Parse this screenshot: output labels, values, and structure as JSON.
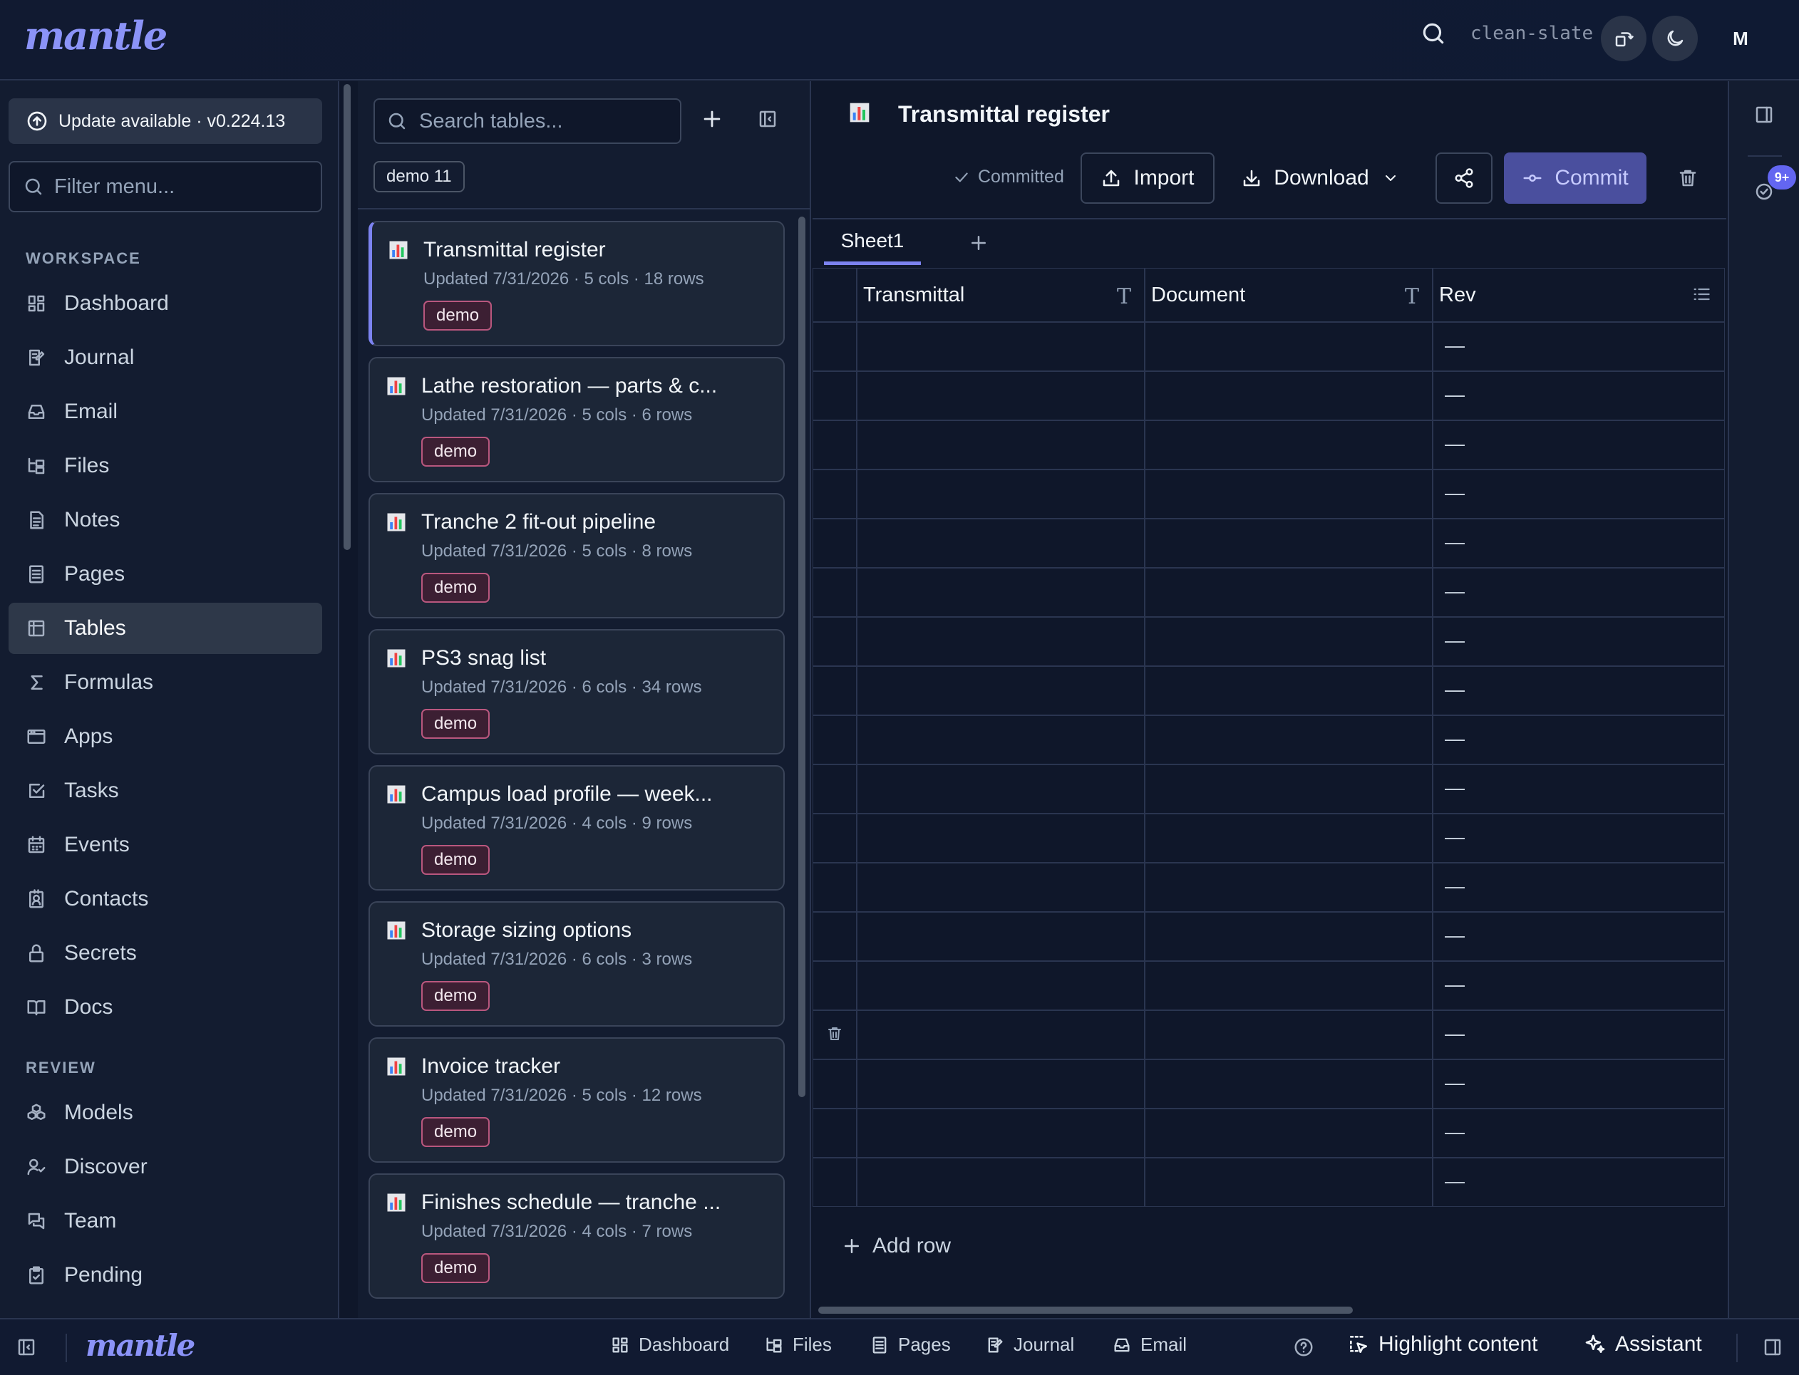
{
  "topbar": {
    "logo": "mantle",
    "workspace": "clean-slate",
    "avatar_initial": "M"
  },
  "sidebar": {
    "update_label": "Update available · v0.224.13",
    "filter_placeholder": "Filter menu...",
    "sections": [
      {
        "title": "WORKSPACE",
        "items": [
          "Dashboard",
          "Journal",
          "Email",
          "Files",
          "Notes",
          "Pages",
          "Tables",
          "Formulas",
          "Apps",
          "Tasks",
          "Events",
          "Contacts",
          "Secrets",
          "Docs"
        ]
      },
      {
        "title": "REVIEW",
        "items": [
          "Models",
          "Discover",
          "Team",
          "Pending"
        ]
      }
    ],
    "active_item": "Tables"
  },
  "table_list": {
    "search_placeholder": "Search tables...",
    "filter_chip": "demo 11",
    "cards": [
      {
        "title": "Transmittal register",
        "meta": "Updated 7/31/2026 · 5 cols · 18 rows",
        "tag": "demo"
      },
      {
        "title": "Lathe restoration — parts & c...",
        "meta": "Updated 7/31/2026 · 5 cols · 6 rows",
        "tag": "demo"
      },
      {
        "title": "Tranche 2 fit-out pipeline",
        "meta": "Updated 7/31/2026 · 5 cols · 8 rows",
        "tag": "demo"
      },
      {
        "title": "PS3 snag list",
        "meta": "Updated 7/31/2026 · 6 cols · 34 rows",
        "tag": "demo"
      },
      {
        "title": "Campus load profile — week...",
        "meta": "Updated 7/31/2026 · 4 cols · 9 rows",
        "tag": "demo"
      },
      {
        "title": "Storage sizing options",
        "meta": "Updated 7/31/2026 · 6 cols · 3 rows",
        "tag": "demo"
      },
      {
        "title": "Invoice tracker",
        "meta": "Updated 7/31/2026 · 5 cols · 12 rows",
        "tag": "demo"
      },
      {
        "title": "Finishes schedule — tranche ...",
        "meta": "Updated 7/31/2026 · 4 cols · 7 rows",
        "tag": "demo"
      }
    ]
  },
  "main": {
    "title": "Transmittal register",
    "status": "Committed",
    "import_label": "Import",
    "download_label": "Download",
    "commit_label": "Commit",
    "sheet_tab": "Sheet1",
    "columns": [
      {
        "name": "Transmittal",
        "type_icon": "T"
      },
      {
        "name": "Document",
        "type_icon": "T"
      },
      {
        "name": "Rev",
        "type_icon": "list-icon"
      }
    ],
    "row_count": 18,
    "empty_value": "—",
    "add_row_label": "Add row"
  },
  "right_rail": {
    "badge": "9+"
  },
  "bottombar": {
    "logo": "mantle",
    "links": [
      "Dashboard",
      "Files",
      "Pages",
      "Journal",
      "Email"
    ],
    "highlight_label": "Highlight content",
    "assistant_label": "Assistant"
  },
  "colors": {
    "accent": "#7c83f0",
    "commit_bg": "#4a4f9e",
    "tag_border": "#b9577e"
  }
}
